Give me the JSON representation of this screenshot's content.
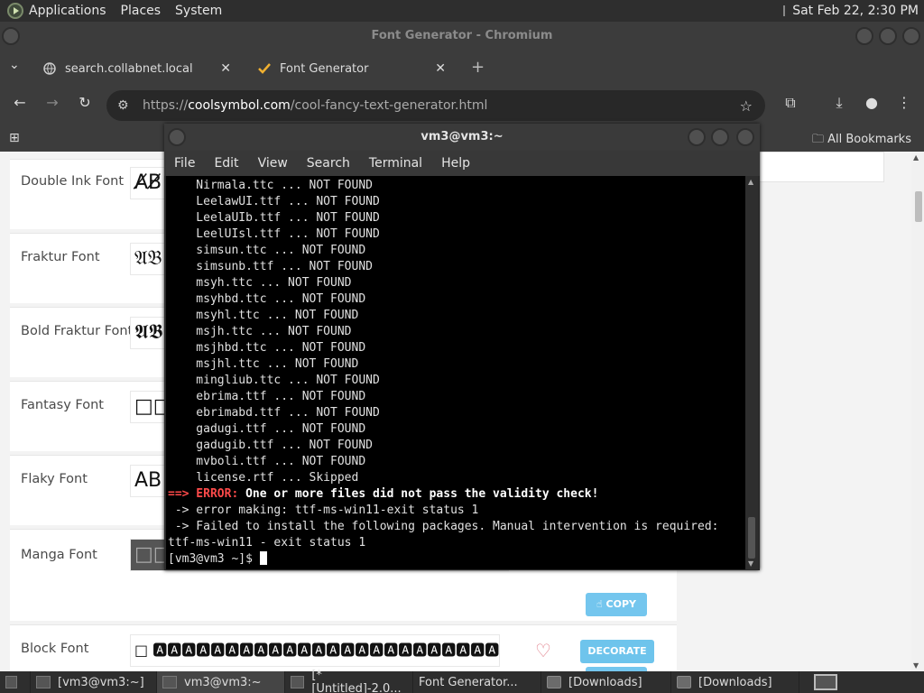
{
  "system_panel": {
    "menus": [
      "Applications",
      "Places",
      "System"
    ],
    "datetime": "Sat Feb 22,  2:30 PM"
  },
  "browser": {
    "window_title": "Font Generator - Chromium",
    "tabs": [
      {
        "label": "search.collabnet.local",
        "active": false
      },
      {
        "label": "Font Generator",
        "active": true
      }
    ],
    "url_prefix": "https://",
    "url_domain": "coolsymbol.com",
    "url_path": "/cool-fancy-text-generator.html",
    "bookmarks_label": "All Bookmarks"
  },
  "page": {
    "rows": [
      {
        "name": "Double Ink Font",
        "preview": "A̸B̸"
      },
      {
        "name": "Fraktur Font",
        "preview": "𝔄𝔅"
      },
      {
        "name": "Bold Fraktur Font",
        "preview": "𝕬𝕭"
      },
      {
        "name": "Fantasy Font",
        "preview": "□□"
      },
      {
        "name": "Flaky Font",
        "preview": "AB"
      },
      {
        "name": "Manga Font",
        "preview": "□□"
      },
      {
        "name": "Block Font",
        "preview": "□ 🅰🅰🅰🅰🅰🅰🅰🅰🅰🅰🅰🅰🅰🅰🅰🅰🅰🅰🅰🅰🅰🅰🅰🅰🅰"
      }
    ],
    "decorate_label": "DECORATE",
    "copy_label": "COPY"
  },
  "terminal": {
    "title": "vm3@vm3:~",
    "menus": [
      "File",
      "Edit",
      "View",
      "Search",
      "Terminal",
      "Help"
    ],
    "lines": [
      {
        "text": "    Nirmala.ttc ... NOT FOUND"
      },
      {
        "text": "    LeelawUI.ttf ... NOT FOUND"
      },
      {
        "text": "    LeelaUIb.ttf ... NOT FOUND"
      },
      {
        "text": "    LeelUIsl.ttf ... NOT FOUND"
      },
      {
        "text": "    simsun.ttc ... NOT FOUND"
      },
      {
        "text": "    simsunb.ttf ... NOT FOUND"
      },
      {
        "text": "    msyh.ttc ... NOT FOUND"
      },
      {
        "text": "    msyhbd.ttc ... NOT FOUND"
      },
      {
        "text": "    msyhl.ttc ... NOT FOUND"
      },
      {
        "text": "    msjh.ttc ... NOT FOUND"
      },
      {
        "text": "    msjhbd.ttc ... NOT FOUND"
      },
      {
        "text": "    msjhl.ttc ... NOT FOUND"
      },
      {
        "text": "    mingliub.ttc ... NOT FOUND"
      },
      {
        "text": "    ebrima.ttf ... NOT FOUND"
      },
      {
        "text": "    ebrimabd.ttf ... NOT FOUND"
      },
      {
        "text": "    gadugi.ttf ... NOT FOUND"
      },
      {
        "text": "    gadugib.ttf ... NOT FOUND"
      },
      {
        "text": "    mvboli.ttf ... NOT FOUND"
      },
      {
        "text": "    license.rtf ... Skipped"
      }
    ],
    "error_arrow": "==>",
    "error_label": " ERROR:",
    "error_message": " One or more files did not pass the validity check!",
    "error_line_2": " -> error making: ttf-ms-win11-exit status 1",
    "error_line_3": " -> Failed to install the following packages. Manual intervention is required:",
    "error_line_4": "ttf-ms-win11 - exit status 1",
    "prompt": "[vm3@vm3 ~]$ "
  },
  "taskbar": {
    "items": [
      {
        "label": "[vm3@vm3:~]",
        "icon": "terminal-icon",
        "active": false
      },
      {
        "label": "vm3@vm3:~",
        "icon": "terminal-icon",
        "active": true
      },
      {
        "label": "[*[Untitled]-2.0...",
        "icon": "gimp-icon",
        "active": false
      },
      {
        "label": "Font Generator...",
        "icon": "chrome-icon",
        "active": false
      },
      {
        "label": "[Downloads]",
        "icon": "folder-icon",
        "active": false
      },
      {
        "label": "[Downloads]",
        "icon": "folder-icon",
        "active": false
      }
    ]
  }
}
